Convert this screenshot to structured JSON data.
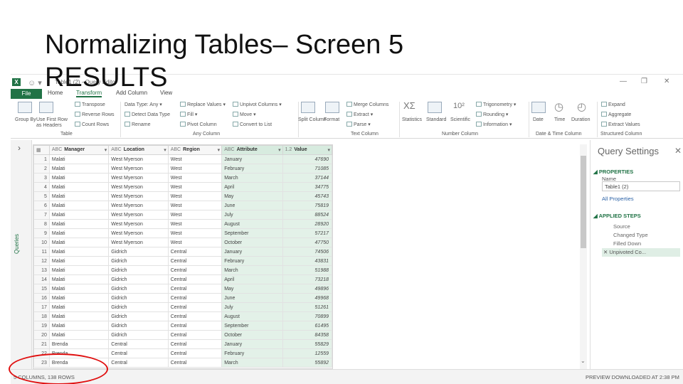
{
  "slide": {
    "title_line1": "Normalizing Tables– Screen 5",
    "title_line2": "RESULTS"
  },
  "window": {
    "title": "Table1 (2) - Query Editor",
    "buttons": [
      "—",
      "❐",
      "✕"
    ]
  },
  "tabs": [
    "File",
    "Home",
    "Transform",
    "Add Column",
    "View"
  ],
  "active_tab": "Transform",
  "ribbon": {
    "groups": [
      {
        "label": "Table",
        "items": [
          "Group By",
          "Use First Row as Headers",
          "Transpose",
          "Reverse Rows",
          "Count Rows"
        ]
      },
      {
        "label": "Any Column",
        "items": [
          "Data Type: Any",
          "Detect Data Type",
          "Rename",
          "Replace Values",
          "Fill",
          "Pivot Column",
          "Unpivot Columns",
          "Move",
          "Convert to List"
        ]
      },
      {
        "label": "Text Column",
        "items": [
          "Split Column",
          "Format",
          "Merge Columns",
          "Extract",
          "Parse"
        ]
      },
      {
        "label": "Number Column",
        "items": [
          "Statistics",
          "Standard",
          "Scientific",
          "Trigonometry",
          "Rounding",
          "Information"
        ]
      },
      {
        "label": "Date & Time Column",
        "items": [
          "Date",
          "Time",
          "Duration"
        ]
      },
      {
        "label": "Structured Column",
        "items": [
          "Expand",
          "Aggregate",
          "Extract Values"
        ]
      }
    ]
  },
  "side_panel": {
    "label": "Queries",
    "chevron": "›"
  },
  "grid": {
    "headers": [
      {
        "type": "ABC",
        "name": "Manager"
      },
      {
        "type": "ABC",
        "name": "Location"
      },
      {
        "type": "ABC",
        "name": "Region"
      },
      {
        "type": "ABC",
        "name": "Attribute"
      },
      {
        "type": "1.2",
        "name": "Value"
      }
    ],
    "rows": [
      [
        "1",
        "Malati",
        "West Myerson",
        "West",
        "January",
        "47690"
      ],
      [
        "2",
        "Malati",
        "West Myerson",
        "West",
        "February",
        "71085"
      ],
      [
        "3",
        "Malati",
        "West Myerson",
        "West",
        "March",
        "37144"
      ],
      [
        "4",
        "Malati",
        "West Myerson",
        "West",
        "April",
        "34775"
      ],
      [
        "5",
        "Malati",
        "West Myerson",
        "West",
        "May",
        "45743"
      ],
      [
        "6",
        "Malati",
        "West Myerson",
        "West",
        "June",
        "75819"
      ],
      [
        "7",
        "Malati",
        "West Myerson",
        "West",
        "July",
        "88524"
      ],
      [
        "8",
        "Malati",
        "West Myerson",
        "West",
        "August",
        "28920"
      ],
      [
        "9",
        "Malati",
        "West Myerson",
        "West",
        "September",
        "57217"
      ],
      [
        "10",
        "Malati",
        "West Myerson",
        "West",
        "October",
        "47750"
      ],
      [
        "11",
        "Malati",
        "Gidrich",
        "Central",
        "January",
        "74506"
      ],
      [
        "12",
        "Malati",
        "Gidrich",
        "Central",
        "February",
        "43831"
      ],
      [
        "13",
        "Malati",
        "Gidrich",
        "Central",
        "March",
        "51988"
      ],
      [
        "14",
        "Malati",
        "Gidrich",
        "Central",
        "April",
        "73218"
      ],
      [
        "15",
        "Malati",
        "Gidrich",
        "Central",
        "May",
        "49896"
      ],
      [
        "16",
        "Malati",
        "Gidrich",
        "Central",
        "June",
        "49968"
      ],
      [
        "17",
        "Malati",
        "Gidrich",
        "Central",
        "July",
        "51261"
      ],
      [
        "18",
        "Malati",
        "Gidrich",
        "Central",
        "August",
        "70899"
      ],
      [
        "19",
        "Malati",
        "Gidrich",
        "Central",
        "September",
        "61495"
      ],
      [
        "20",
        "Malati",
        "Gidrich",
        "Central",
        "October",
        "84358"
      ],
      [
        "21",
        "Brenda",
        "Central",
        "Central",
        "January",
        "55829"
      ],
      [
        "22",
        "Brenda",
        "Central",
        "Central",
        "February",
        "12559"
      ],
      [
        "23",
        "Brenda",
        "Central",
        "Central",
        "March",
        "55892"
      ]
    ]
  },
  "query_settings": {
    "title": "Query Settings",
    "properties_label": "PROPERTIES",
    "name_label": "Name",
    "name_value": "Table1 (2)",
    "all_properties": "All Properties",
    "applied_steps_label": "APPLIED STEPS",
    "steps": [
      "Source",
      "Changed Type",
      "Filled Down",
      "Unpivoted Co..."
    ],
    "selected_step": 3
  },
  "status": {
    "left": "5 COLUMNS, 138 ROWS",
    "right": "PREVIEW DOWNLOADED AT 2:38 PM"
  },
  "colors": {
    "accent": "#217346",
    "annotation": "#e01010"
  }
}
